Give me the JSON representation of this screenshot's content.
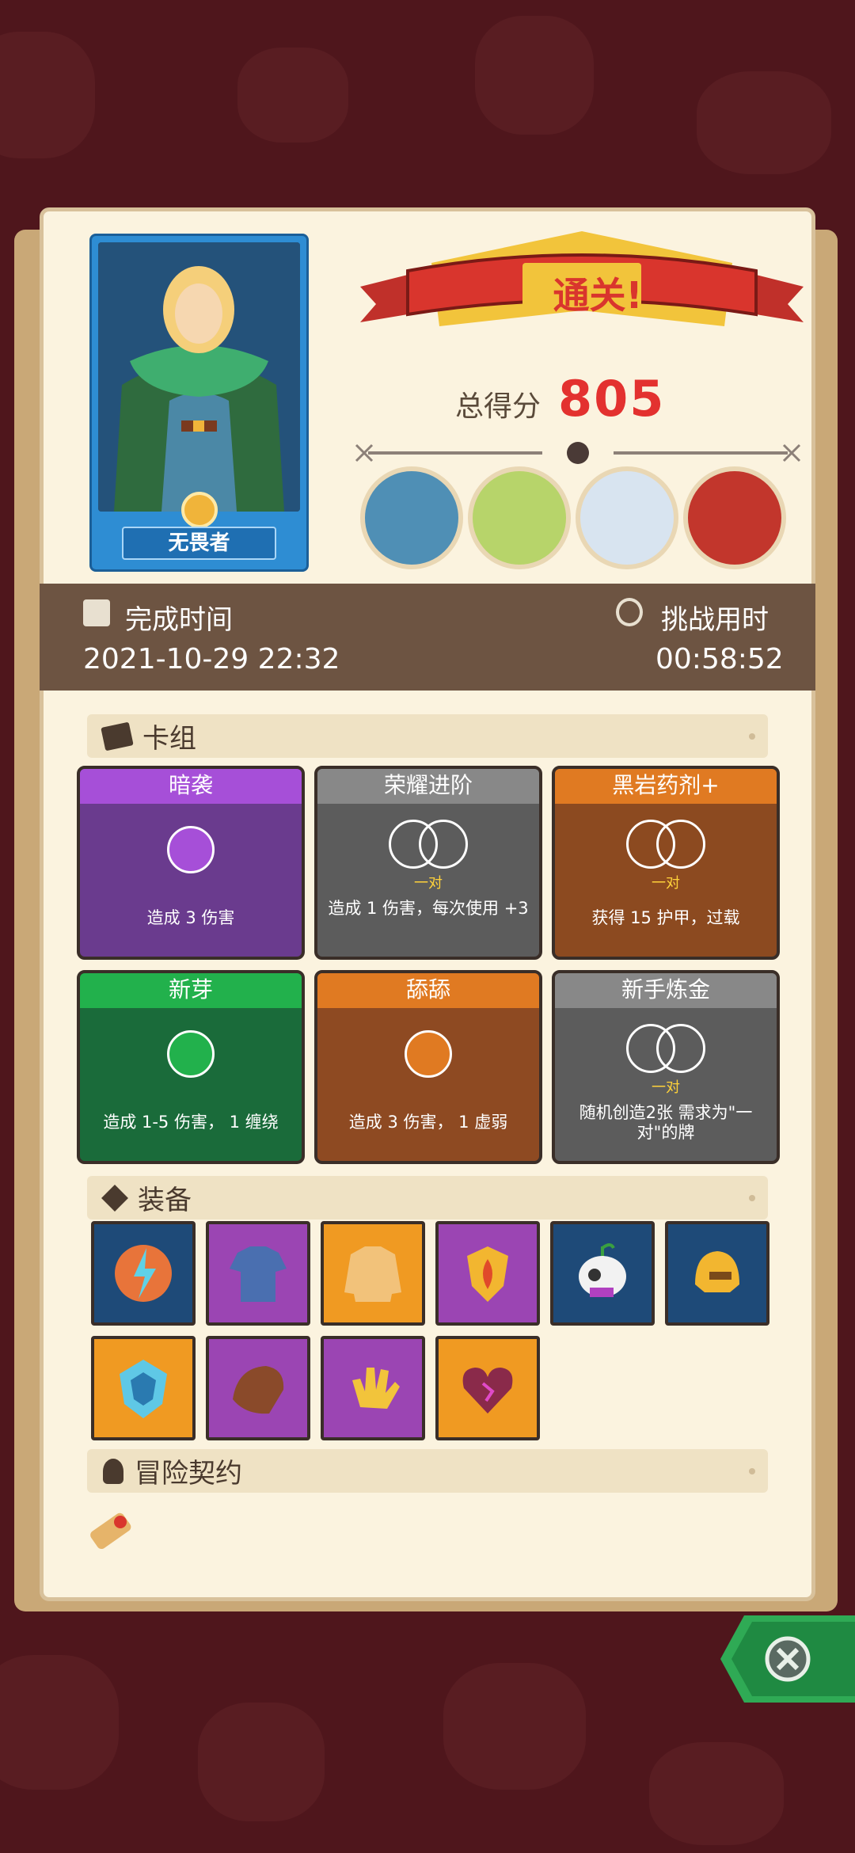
{
  "hero": {
    "name": "无畏者"
  },
  "result": {
    "banner": "通关!",
    "score_label": "总得分",
    "score_value": "805"
  },
  "time": {
    "complete_label": "完成时间",
    "complete_value": "2021-10-29 22:32",
    "challenge_label": "挑战用时",
    "challenge_value": "00:58:52"
  },
  "deck": {
    "title": "卡组",
    "cards": [
      {
        "name": "暗袭",
        "text": "造成 3 伤害",
        "pair": ""
      },
      {
        "name": "荣耀进阶",
        "text": "造成 1 伤害，每次使用 +3",
        "pair": "一对"
      },
      {
        "name": "黑岩药剂+",
        "text": "获得 15 护甲，过载",
        "pair": "一对"
      },
      {
        "name": "新芽",
        "text": "造成 1-5 伤害， 1 缠绕",
        "pair": ""
      },
      {
        "name": "舔舔",
        "text": "造成 3 伤害， 1 虚弱",
        "pair": ""
      },
      {
        "name": "新手炼金",
        "text": "随机创造2张 需求为\"一对\"的牌",
        "pair": "一对"
      }
    ]
  },
  "equipment": {
    "title": "装备",
    "items": [
      "lightning-orb-icon",
      "tunic-icon",
      "sweater-icon",
      "flame-shield-icon",
      "skull-sprout-icon",
      "golden-helmet-icon",
      "ice-crest-icon",
      "leather-pauldron-icon",
      "golden-glove-icon",
      "thorn-heart-icon"
    ]
  },
  "contract": {
    "title": "冒险契约"
  },
  "colors": {
    "purple": "#6a3b8e",
    "grey": "#5c5c5c",
    "brown": "#8c4a20",
    "green": "#1a6b3a",
    "orange_card": "#8e4a22",
    "equip_blue": "#1e4a78",
    "equip_purple": "#9b45b3",
    "equip_orange": "#f09a22"
  }
}
